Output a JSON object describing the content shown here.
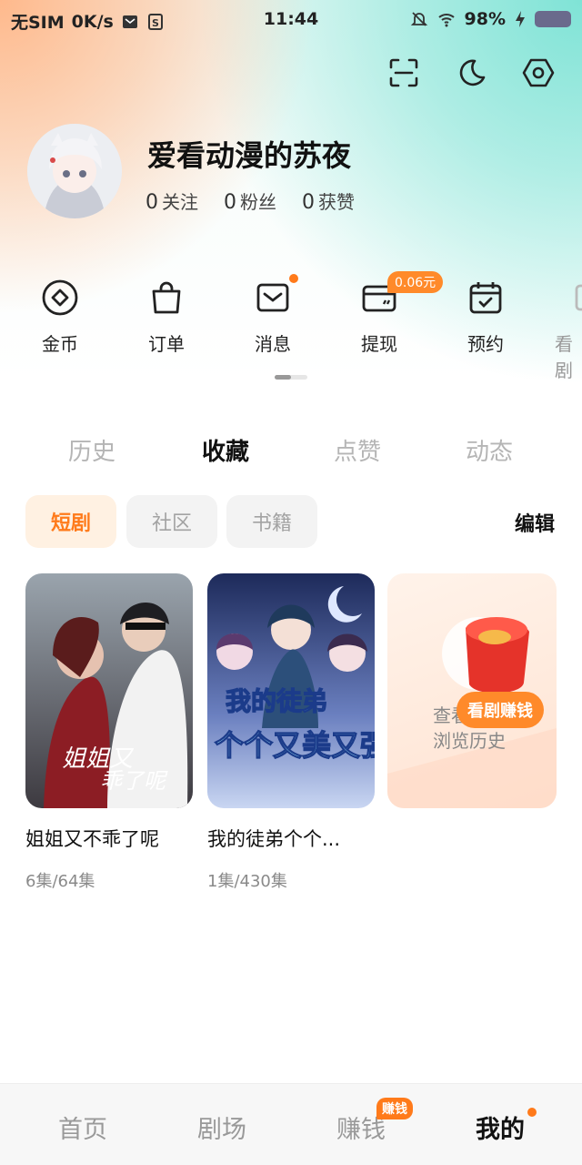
{
  "status_bar": {
    "carrier": "无SIM",
    "speed": "0K/s",
    "time": "11:44",
    "battery": "98%"
  },
  "profile": {
    "username": "爱看动漫的苏夜",
    "stats": [
      {
        "num": "0",
        "label": "关注"
      },
      {
        "num": "0",
        "label": "粉丝"
      },
      {
        "num": "0",
        "label": "获赞"
      }
    ]
  },
  "shortcuts": [
    {
      "label": "金币",
      "icon": "coin-icon"
    },
    {
      "label": "订单",
      "icon": "bag-icon"
    },
    {
      "label": "消息",
      "icon": "mail-icon"
    },
    {
      "label": "提现",
      "icon": "wallet-icon"
    },
    {
      "label": "预约",
      "icon": "calendar-icon"
    },
    {
      "label": "看剧",
      "icon": "tv-icon"
    }
  ],
  "withdraw_badge": "0.06元",
  "tabs": [
    "历史",
    "收藏",
    "点赞",
    "动态"
  ],
  "active_tab": "收藏",
  "chips": [
    "短剧",
    "社区",
    "书籍"
  ],
  "edit_label": "编辑",
  "cards": [
    {
      "title": "姐姐又不乖了呢",
      "episodes": "6集/64集"
    },
    {
      "title": "我的徒弟个个...",
      "episodes": "1集/430集"
    }
  ],
  "promo": {
    "line1": "查看",
    "line2": "浏览历史",
    "button": "看剧赚钱"
  },
  "bottom_nav": [
    "首页",
    "剧场",
    "赚钱",
    "我的"
  ],
  "bottom_nav_badge": "赚钱",
  "colors": {
    "accent": "#ff7a1a",
    "active_chip_bg": "#fff1e2"
  }
}
